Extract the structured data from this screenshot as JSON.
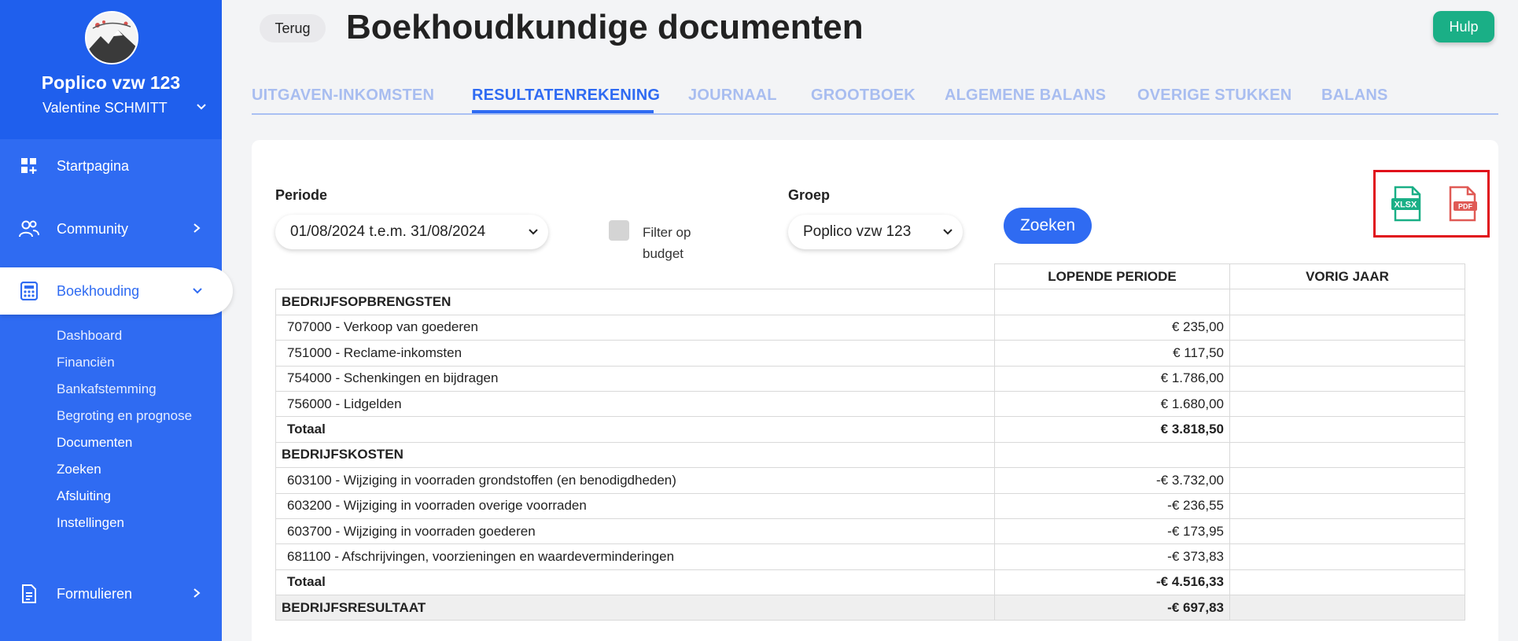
{
  "sidebar": {
    "org_name": "Poplico vzw 123",
    "user_name": "Valentine SCHMITT",
    "nav": {
      "home": "Startpagina",
      "community": "Community",
      "accounting": "Boekhouding",
      "forms": "Formulieren"
    },
    "sub_items": [
      "Dashboard",
      "Financiën",
      "Bankafstemming",
      "Begroting en prognose",
      "Documenten",
      "Zoeken",
      "Afsluiting",
      "Instellingen"
    ]
  },
  "header": {
    "back_label": "Terug",
    "title": "Boekhoudkundige documenten",
    "help_label": "Hulp"
  },
  "tabs": [
    "UITGAVEN-INKOMSTEN",
    "RESULTATENREKENING",
    "JOURNAAL",
    "GROOTBOEK",
    "ALGEMENE BALANS",
    "OVERIGE STUKKEN",
    "BALANS"
  ],
  "active_tab": "RESULTATENREKENING",
  "filters": {
    "period_label": "Periode",
    "period_value": "01/08/2024 t.e.m. 31/08/2024",
    "budget_filter_label": "Filter op budget",
    "budget_checked": false,
    "group_label": "Groep",
    "group_value": "Poplico vzw 123",
    "search_label": "Zoeken"
  },
  "exports": {
    "xlsx_label": "XLSX",
    "pdf_label": "PDF",
    "xlsx_color": "#1aaf86",
    "pdf_color": "#e05a55"
  },
  "table": {
    "headers": [
      "LOPENDE PERIODE",
      "VORIG JAAR"
    ],
    "revenue_section": "BEDRIJFSOPBRENGSTEN",
    "revenue_rows": [
      {
        "account": "707000 - Verkoop van goederen",
        "current": "€ 235,00",
        "previous": ""
      },
      {
        "account": "751000 - Reclame-inkomsten",
        "current": "€ 117,50",
        "previous": ""
      },
      {
        "account": "754000 - Schenkingen en bijdragen",
        "current": "€ 1.786,00",
        "previous": ""
      },
      {
        "account": "756000 - Lidgelden",
        "current": "€ 1.680,00",
        "previous": ""
      }
    ],
    "revenue_total": {
      "label": "Totaal",
      "current": "€ 3.818,50",
      "previous": ""
    },
    "cost_section": "BEDRIJFSKOSTEN",
    "cost_rows": [
      {
        "account": "603100 - Wijziging in voorraden grondstoffen (en benodigdheden)",
        "current": "-€ 3.732,00",
        "previous": ""
      },
      {
        "account": "603200 - Wijziging in voorraden overige voorraden",
        "current": "-€ 236,55",
        "previous": ""
      },
      {
        "account": "603700 - Wijziging in voorraden goederen",
        "current": "-€ 173,95",
        "previous": ""
      },
      {
        "account": "681100 - Afschrijvingen, voorzieningen en waardeverminderingen",
        "current": "-€ 373,83",
        "previous": ""
      }
    ],
    "cost_total": {
      "label": "Totaal",
      "current": "-€ 4.516,33",
      "previous": ""
    },
    "result": {
      "label": "BEDRIJFSRESULTAAT",
      "current": "-€ 697,83",
      "previous": ""
    }
  }
}
